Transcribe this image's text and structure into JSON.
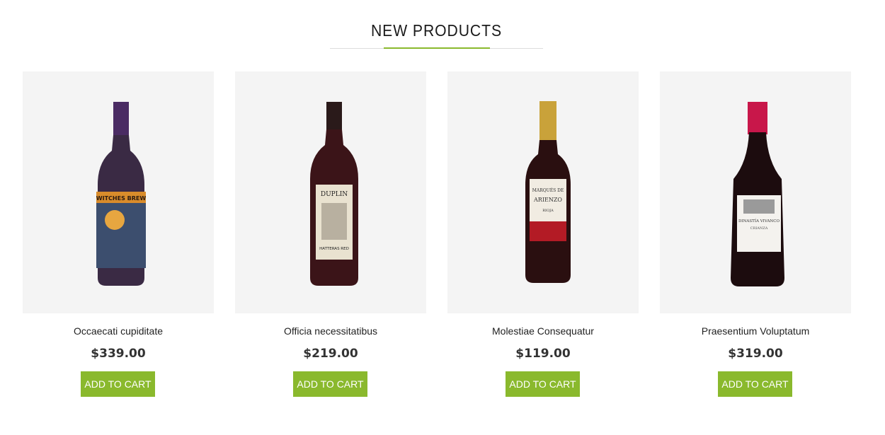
{
  "section": {
    "title": "NEW PRODUCTS",
    "accent_color": "#8ab92d"
  },
  "products": [
    {
      "name": "Occaecati cupiditate",
      "price": "$339.00",
      "button_label": "ADD TO CART",
      "image_icon": "wine-bottle-icon",
      "label_text": "WITCHES BREW",
      "capsule_color": "#4a2b63",
      "bottle_color": "#3a2a44",
      "label_color": "#d98c2b"
    },
    {
      "name": "Officia necessitatibus",
      "price": "$219.00",
      "button_label": "ADD TO CART",
      "image_icon": "wine-bottle-icon",
      "label_text": "DUPLIN",
      "label_text_2": "HATTERAS RED",
      "capsule_color": "#2a1a1a",
      "bottle_color": "#3b1418",
      "label_color": "#e9e2d0"
    },
    {
      "name": "Molestiae Consequatur",
      "price": "$119.00",
      "button_label": "ADD TO CART",
      "image_icon": "wine-bottle-icon",
      "label_text": "MARQUÉS DE ARIENZO",
      "label_text_2": "RIOJA",
      "capsule_color": "#c9a23a",
      "bottle_color": "#2a0f10",
      "label_color": "#f1ece2"
    },
    {
      "name": "Praesentium Voluptatum",
      "price": "$319.00",
      "button_label": "ADD TO CART",
      "image_icon": "wine-bottle-icon",
      "label_text": "DINASTÍA VIVANCO",
      "label_text_2": "CRIANZA",
      "capsule_color": "#c8174a",
      "bottle_color": "#1c0c0e",
      "label_color": "#f4f2ee"
    }
  ]
}
